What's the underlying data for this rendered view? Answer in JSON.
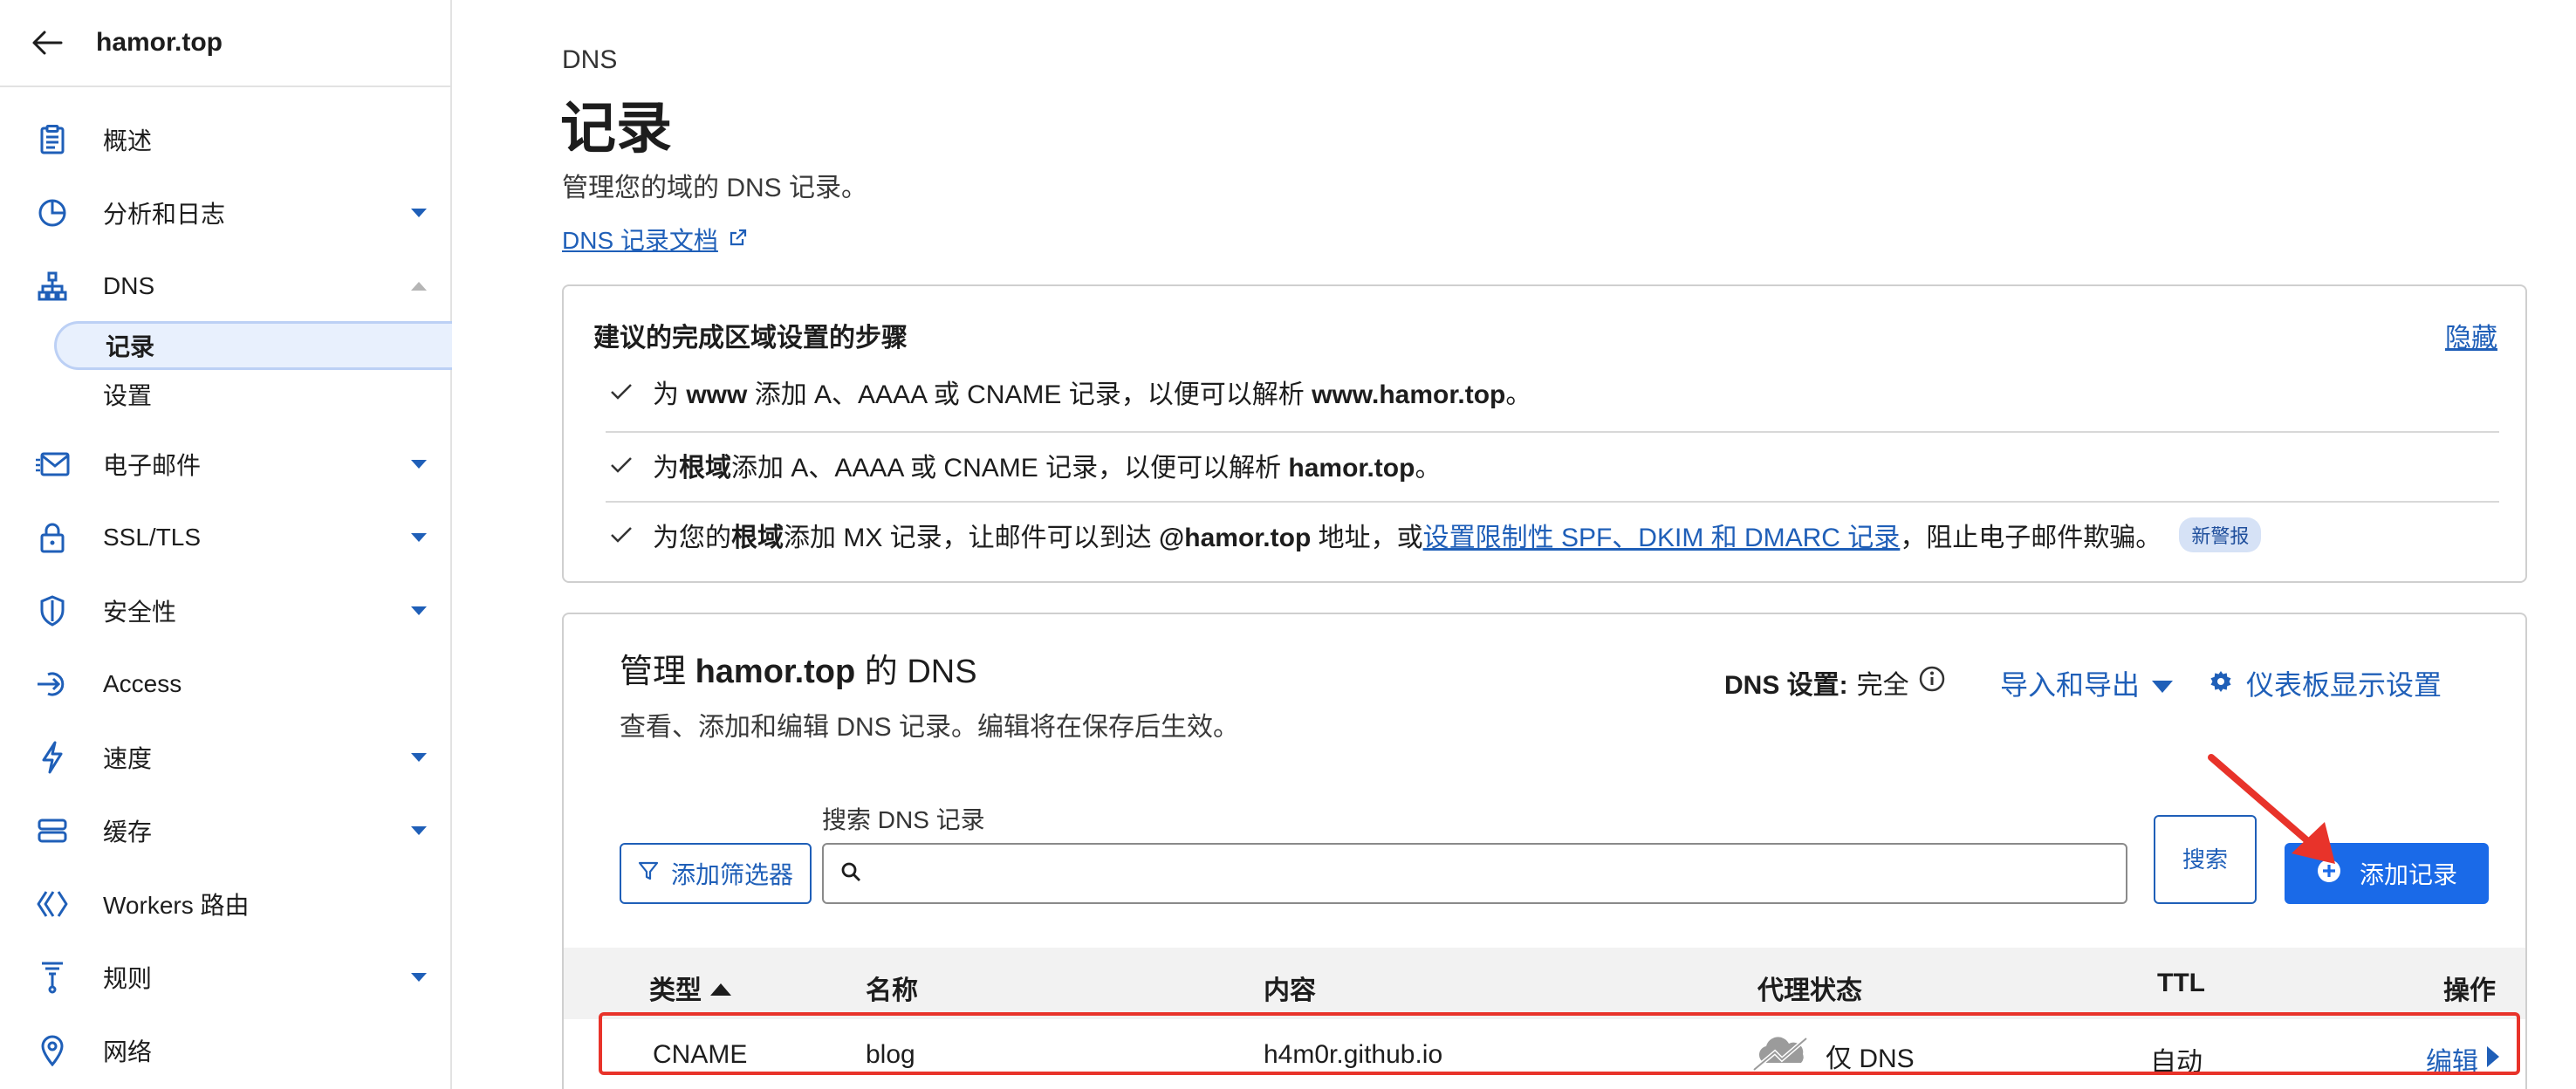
{
  "sidebar": {
    "domain": "hamor.top",
    "items": [
      {
        "label": "概述",
        "icon": "clipboard-icon",
        "has_caret": false
      },
      {
        "label": "分析和日志",
        "icon": "pie-chart-icon",
        "has_caret": true
      },
      {
        "label": "DNS",
        "icon": "network-icon",
        "has_caret": true,
        "expanded": true
      },
      {
        "label": "电子邮件",
        "icon": "email-icon",
        "has_caret": true
      },
      {
        "label": "SSL/TLS",
        "icon": "lock-icon",
        "has_caret": true
      },
      {
        "label": "安全性",
        "icon": "shield-icon",
        "has_caret": true
      },
      {
        "label": "Access",
        "icon": "access-icon",
        "has_caret": false
      },
      {
        "label": "速度",
        "icon": "lightning-icon",
        "has_caret": true
      },
      {
        "label": "缓存",
        "icon": "storage-icon",
        "has_caret": true
      },
      {
        "label": "Workers 路由",
        "icon": "workers-icon",
        "has_caret": false
      },
      {
        "label": "规则",
        "icon": "rules-icon",
        "has_caret": true
      },
      {
        "label": "网络",
        "icon": "location-pin-icon",
        "has_caret": false
      }
    ],
    "dns_sub": [
      "记录",
      "设置"
    ]
  },
  "page": {
    "eyebrow": "DNS",
    "title": "记录",
    "description": "管理您的域的 DNS 记录。",
    "doc_link": "DNS 记录文档"
  },
  "steps_card": {
    "title": "建议的完成区域设置的步骤",
    "hide": "隐藏",
    "step1": {
      "a": "为 ",
      "b": "www",
      "c": " 添加 A、AAAA 或 CNAME 记录，以便可以解析 ",
      "d": "www.hamor.top",
      "e": "。"
    },
    "step2": {
      "a": "为",
      "b": "根域",
      "c": "添加 A、AAAA 或 CNAME 记录，以便可以解析 ",
      "d": "hamor.top",
      "e": "。"
    },
    "step3": {
      "a": "为您的",
      "b": "根域",
      "c": "添加 MX 记录，让邮件可以到达 ",
      "d": "@hamor.top",
      "e": " 地址，或",
      "link": "设置限制性 SPF、DKIM 和 DMARC 记录",
      "f": "，阻止电子邮件欺骗。",
      "badge": "新警报"
    }
  },
  "manage": {
    "title_pre": "管理 ",
    "title_domain": "hamor.top",
    "title_post": " 的 DNS",
    "description": "查看、添加和编辑 DNS 记录。编辑将在保存后生效。",
    "dns_setting_label": "DNS 设置:",
    "dns_setting_value": "完全",
    "import_export": "导入和导出",
    "dashboard_settings": "仪表板显示设置",
    "filter_button": "添加筛选器",
    "search_label": "搜索 DNS 记录",
    "search_placeholder": "",
    "search_button": "搜索",
    "add_record": "添加记录"
  },
  "table": {
    "headers": {
      "type": "类型",
      "name": "名称",
      "content": "内容",
      "proxy": "代理状态",
      "ttl": "TTL",
      "actions": "操作"
    },
    "rows": [
      {
        "type": "CNAME",
        "name": "blog",
        "content": "h4m0r.github.io",
        "proxy": "仅 DNS",
        "ttl": "自动",
        "action": "编辑"
      }
    ]
  },
  "colors": {
    "accent": "#1a6ae8",
    "link": "#1f5fb8",
    "annotation": "#e8332a"
  }
}
